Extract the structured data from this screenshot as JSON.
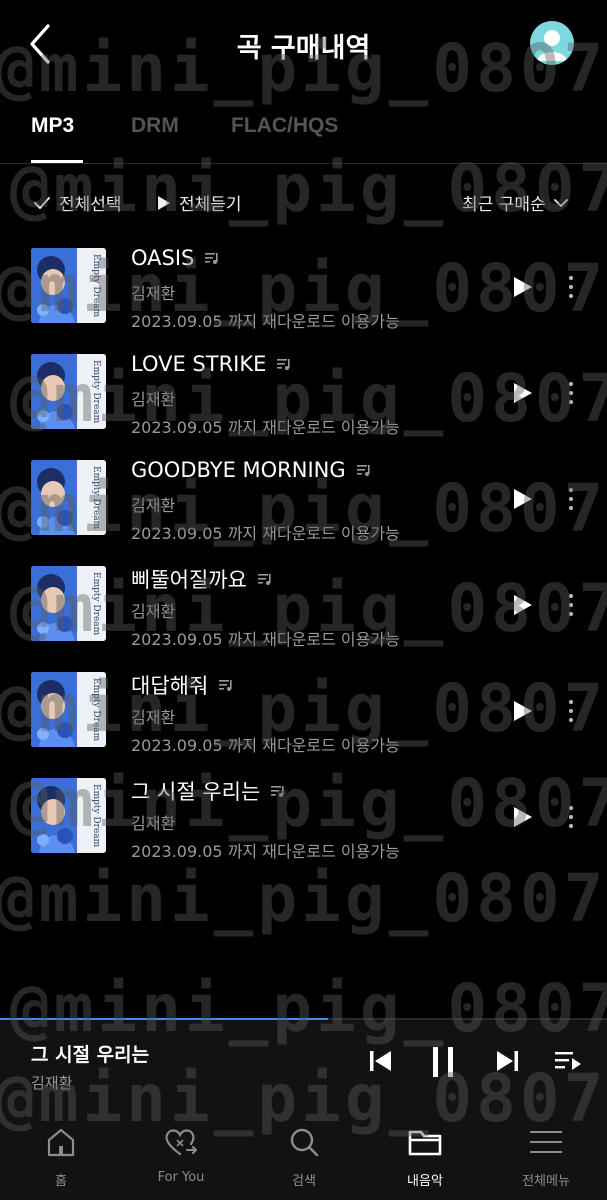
{
  "header": {
    "title": "곡 구매내역"
  },
  "tabs": [
    {
      "label": "MP3",
      "active": true
    },
    {
      "label": "DRM",
      "active": false
    },
    {
      "label": "FLAC/HQS",
      "active": false
    }
  ],
  "toolbar": {
    "select_all": "전체선택",
    "play_all": "전체듣기",
    "sort": "최근 구매순"
  },
  "songs": [
    {
      "title": "OASIS",
      "artist": "김재환",
      "expiry": "2023.09.05 까지 재다운로드 이용가능"
    },
    {
      "title": "LOVE STRIKE",
      "artist": "김재환",
      "expiry": "2023.09.05 까지 재다운로드 이용가능"
    },
    {
      "title": "GOODBYE MORNING",
      "artist": "김재환",
      "expiry": "2023.09.05 까지 재다운로드 이용가능"
    },
    {
      "title": "삐뚤어질까요",
      "artist": "김재환",
      "expiry": "2023.09.05 까지 재다운로드 이용가능"
    },
    {
      "title": "대답해줘",
      "artist": "김재환",
      "expiry": "2023.09.05 까지 재다운로드 이용가능"
    },
    {
      "title": "그 시절 우리는",
      "artist": "김재환",
      "expiry": "2023.09.05 까지 재다운로드 이용가능"
    }
  ],
  "album_art_text": "Empty Dream",
  "now_playing": {
    "title": "그 시절 우리는",
    "artist": "김재환",
    "progress": 0.54
  },
  "nav": [
    {
      "label": "홈",
      "icon": "home-icon",
      "active": false
    },
    {
      "label": "For You",
      "icon": "heart-icon",
      "active": false
    },
    {
      "label": "검색",
      "icon": "search-icon",
      "active": false
    },
    {
      "label": "내음악",
      "icon": "folder-icon",
      "active": true
    },
    {
      "label": "전체메뉴",
      "icon": "menu-icon",
      "active": false
    }
  ],
  "watermark": "@mini_pig_0807",
  "colors": {
    "accent": "#3d8cf0",
    "background": "#000000",
    "secondary_text": "#9a9a9a"
  }
}
